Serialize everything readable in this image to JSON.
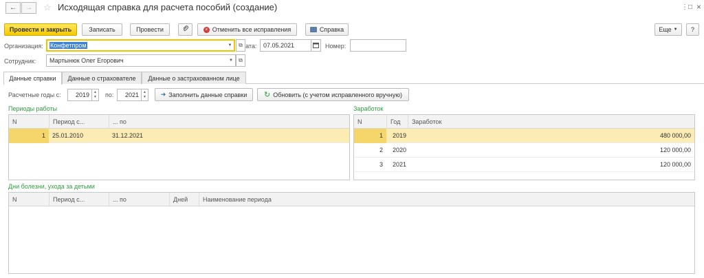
{
  "window": {
    "title": "Исходящая справка для расчета пособий (создание)",
    "back_glyph": "←",
    "forward_glyph": "→",
    "star_glyph": "☆",
    "more_glyph": "⋮",
    "restore_glyph": "□",
    "close_glyph": "×"
  },
  "toolbar": {
    "post_close": "Провести и закрыть",
    "save": "Записать",
    "post": "Провести",
    "cancel_corrections": "Отменить все исправления",
    "certificate": "Справка",
    "more": "Еще",
    "help": "?"
  },
  "header": {
    "org_label": "Организация:",
    "org_value": "Конфетпром",
    "date_label": "Дата:",
    "date_value": "07.05.2021",
    "number_label": "Номер:",
    "number_value": "",
    "employee_label": "Сотрудник:",
    "employee_value": "Мартынюк Олег Егорович"
  },
  "tabs": [
    {
      "label": "Данные справки"
    },
    {
      "label": "Данные о страхователе"
    },
    {
      "label": "Данные о застрахованном лице"
    }
  ],
  "years": {
    "label_from": "Расчетные годы с:",
    "from": "2019",
    "label_to": "по:",
    "to": "2021",
    "fill_button": "Заполнить данные справки",
    "refresh_button": "Обновить (с учетом исправленного вручную)"
  },
  "work_periods": {
    "title": "Периоды работы",
    "columns": [
      "N",
      "Период с...",
      "... по"
    ],
    "rows": [
      {
        "n": "1",
        "from": "25.01.2010",
        "to": "31.12.2021"
      }
    ]
  },
  "earnings": {
    "title": "Заработок",
    "columns": [
      "N",
      "Год",
      "Заработок"
    ],
    "rows": [
      {
        "n": "1",
        "year": "2019",
        "amount": "480 000,00"
      },
      {
        "n": "2",
        "year": "2020",
        "amount": "120 000,00"
      },
      {
        "n": "3",
        "year": "2021",
        "amount": "120 000,00"
      }
    ]
  },
  "sick_days": {
    "title": "Дни болезни, ухода за детьми",
    "columns": [
      "N",
      "Период с...",
      "... по",
      "Дней",
      "Наименование периода"
    ]
  },
  "colors": {
    "accent_yellow": "#f5c800",
    "section_green": "#2e9e3e",
    "selected_row": "#fbecb4"
  }
}
